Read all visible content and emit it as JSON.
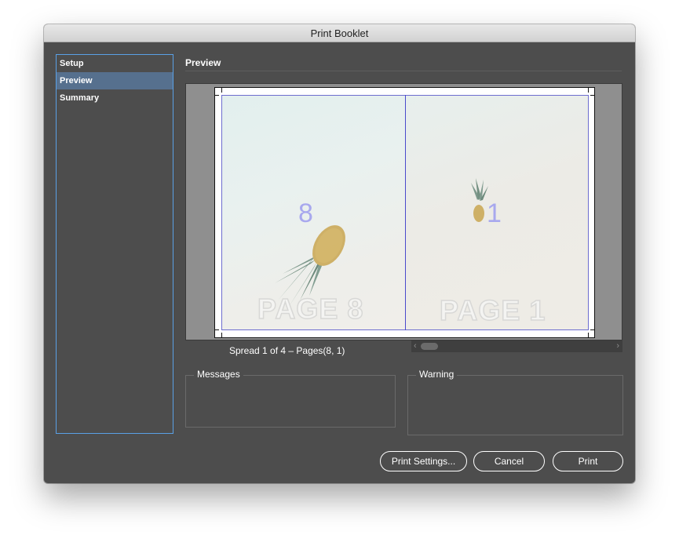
{
  "window": {
    "title": "Print Booklet"
  },
  "sidebar": {
    "items": [
      {
        "label": "Setup",
        "selected": false
      },
      {
        "label": "Preview",
        "selected": true
      },
      {
        "label": "Summary",
        "selected": false
      }
    ]
  },
  "preview": {
    "section_title": "Preview",
    "spread_info": "Spread 1 of 4 – Pages(8, 1)",
    "left_page": {
      "number": "8",
      "label": "PAGE 8"
    },
    "right_page": {
      "number": "1",
      "label": "PAGE 1"
    }
  },
  "messages": {
    "title": "Messages"
  },
  "warning": {
    "title": "Warning"
  },
  "buttons": {
    "print_settings": "Print Settings...",
    "cancel": "Cancel",
    "print": "Print"
  },
  "icons": {
    "scroll_left": "chevron-left-icon",
    "scroll_right": "chevron-right-icon"
  },
  "colors": {
    "window_bg": "#4d4d4d",
    "selected_item": "#56708e",
    "sidebar_border": "#5aa0e6",
    "page_frame": "#6d6dcf"
  }
}
